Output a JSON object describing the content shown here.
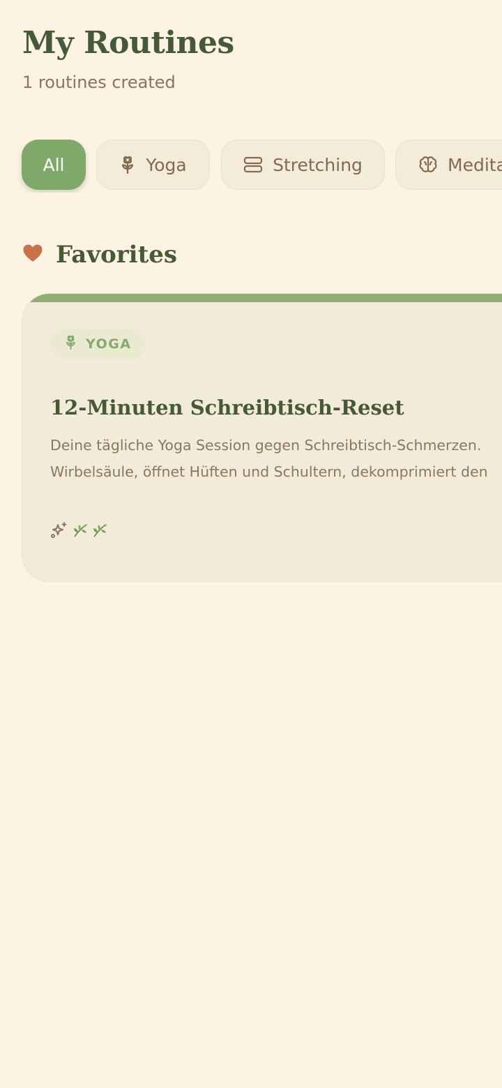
{
  "header": {
    "title": "My Routines",
    "subtitle": "1 routines created"
  },
  "filters": [
    {
      "label": "All",
      "icon": null,
      "active": true
    },
    {
      "label": "Yoga",
      "icon": "flower-icon",
      "active": false
    },
    {
      "label": "Stretching",
      "icon": "stretch-bars-icon",
      "active": false
    },
    {
      "label": "Medita",
      "icon": "brain-icon",
      "active": false
    }
  ],
  "favorites": {
    "title": "Favorites",
    "icon": "heart-icon"
  },
  "routine_card": {
    "category": "YOGA",
    "category_icon": "flower-icon",
    "title": "12-Minuten Schreibtisch-Reset",
    "description_lines": [
      "Deine tägliche Yoga Session gegen Schreibtisch-Schmerzen.",
      "Wirbelsäule, öffnet Hüften und Schultern, dekomprimiert den"
    ],
    "emoji_icons": [
      "sparkles-icon",
      "herb-icon",
      "herb-icon"
    ]
  },
  "colors": {
    "background": "#fcf3e4",
    "primary_green": "#7fa96b",
    "title_green": "#465a35",
    "muted_brown": "#8a745c",
    "heart": "#c9724a",
    "card_accent": "#8fae74"
  }
}
